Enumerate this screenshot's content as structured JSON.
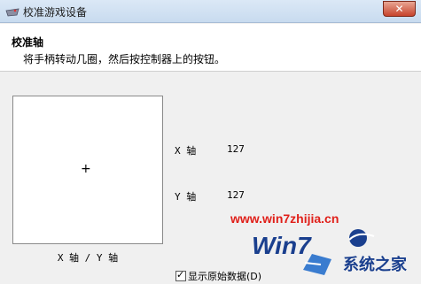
{
  "window": {
    "title": "校准游戏设备",
    "close_icon": "✕",
    "app_icon": "joystick-icon"
  },
  "header": {
    "title": "校准轴",
    "description": "将手柄转动几圈，然后按控制器上的按钮。"
  },
  "axis_area": {
    "crosshair": "+",
    "caption": "X 轴 / Y 轴"
  },
  "readouts": {
    "x_label": "X 轴",
    "x_value": "127",
    "y_label": "Y 轴",
    "y_value": "127"
  },
  "show_raw": {
    "checked": true,
    "check_mark": "✓",
    "label": "显示原始数据(D)"
  },
  "watermark": {
    "url": "www.win7zhijia.cn",
    "logo_text": "Win7",
    "site_name": "系统之家",
    "colors": {
      "url": "#e0201a",
      "logo_blue": "#1a3f8e"
    }
  }
}
